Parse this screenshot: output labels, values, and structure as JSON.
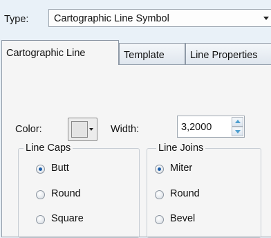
{
  "type_row": {
    "label": "Type:",
    "selected": "Cartographic Line Symbol"
  },
  "tabs": [
    {
      "label": "Cartographic Line",
      "active": true
    },
    {
      "label": "Template",
      "active": false
    },
    {
      "label": "Line Properties",
      "active": false
    }
  ],
  "color": {
    "label": "Color:",
    "swatch_color": "#e4e4e4"
  },
  "width": {
    "label": "Width:",
    "value": "3,2000"
  },
  "line_caps": {
    "title": "Line Caps",
    "options": [
      {
        "label": "Butt",
        "checked": true
      },
      {
        "label": "Round",
        "checked": false
      },
      {
        "label": "Square",
        "checked": false
      }
    ]
  },
  "line_joins": {
    "title": "Line Joins",
    "options": [
      {
        "label": "Miter",
        "checked": true
      },
      {
        "label": "Round",
        "checked": false
      },
      {
        "label": "Bevel",
        "checked": false
      }
    ]
  }
}
